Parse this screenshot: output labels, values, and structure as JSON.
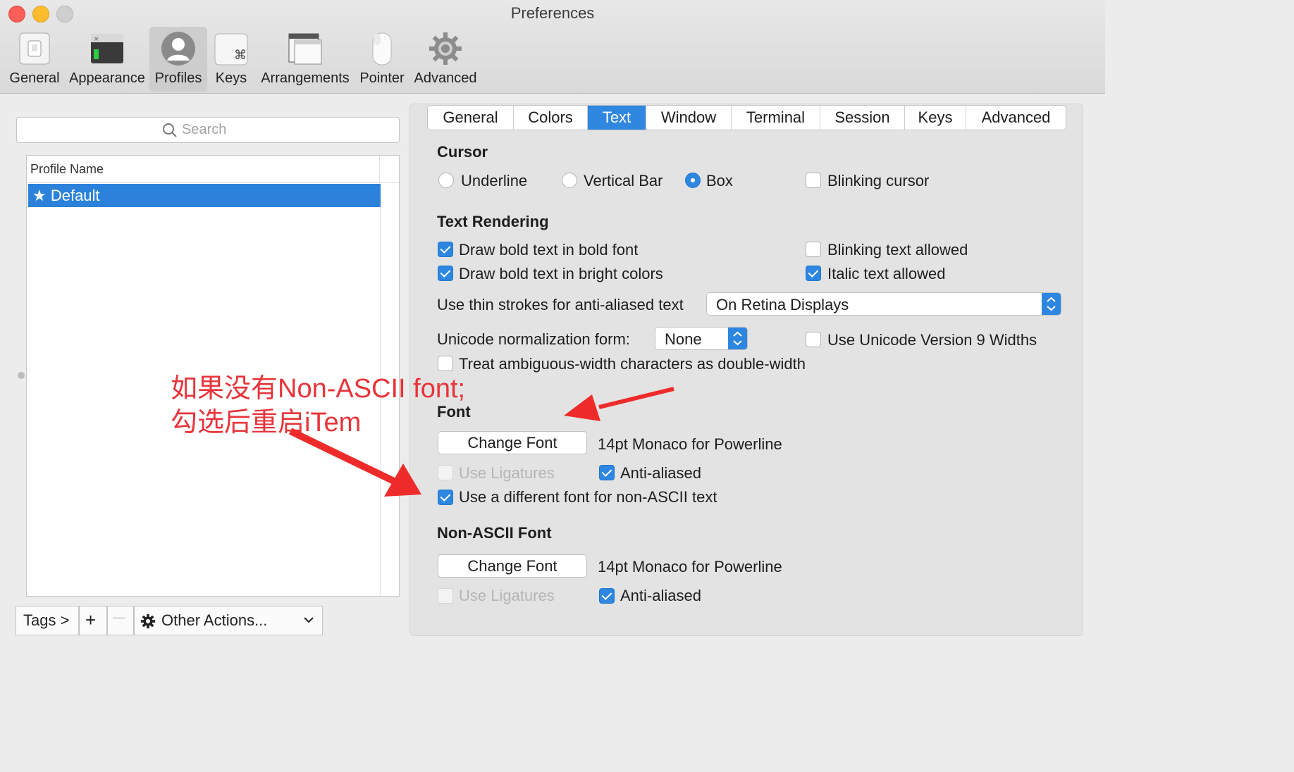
{
  "window": {
    "title": "Preferences"
  },
  "toolbar": {
    "items": [
      {
        "label": "General",
        "icon": "switch-icon"
      },
      {
        "label": "Appearance",
        "icon": "terminal-window-icon"
      },
      {
        "label": "Profiles",
        "icon": "user-silhouette-icon",
        "selected": true
      },
      {
        "label": "Keys",
        "icon": "command-key-icon"
      },
      {
        "label": "Arrangements",
        "icon": "windows-stack-icon"
      },
      {
        "label": "Pointer",
        "icon": "mouse-icon"
      },
      {
        "label": "Advanced",
        "icon": "gear-icon"
      }
    ]
  },
  "sidebar": {
    "search_placeholder": "Search",
    "column_header": "Profile Name",
    "profiles": [
      {
        "label": "★ Default",
        "selected": true
      }
    ],
    "tags_button": "Tags >",
    "add_button": "+",
    "remove_button": "—",
    "other_actions": "Other Actions..."
  },
  "tabs": [
    "General",
    "Colors",
    "Text",
    "Window",
    "Terminal",
    "Session",
    "Keys",
    "Advanced"
  ],
  "active_tab": "Text",
  "cursor": {
    "heading": "Cursor",
    "underline": "Underline",
    "vertical_bar": "Vertical Bar",
    "box": "Box",
    "selected": "Box",
    "blinking": "Blinking cursor",
    "blinking_checked": false
  },
  "text_rendering": {
    "heading": "Text Rendering",
    "bold_font": "Draw bold text in bold font",
    "bold_bright": "Draw bold text in bright colors",
    "blinking_text": "Blinking text allowed",
    "italic_text": "Italic text allowed",
    "thin_strokes_label": "Use thin strokes for anti-aliased text",
    "thin_strokes_value": "On Retina Displays",
    "unicode_label": "Unicode normalization form:",
    "unicode_value": "None",
    "unicode_v9": "Use Unicode Version 9 Widths",
    "ambiguous": "Treat ambiguous-width characters as double-width"
  },
  "font": {
    "heading": "Font",
    "change_font": "Change Font",
    "font_name": "14pt Monaco for Powerline",
    "ligatures": "Use Ligatures",
    "anti_aliased": "Anti-aliased",
    "non_ascii_toggle": "Use a different font for non-ASCII text"
  },
  "non_ascii_font": {
    "heading": "Non-ASCII Font",
    "change_font": "Change Font",
    "font_name": "14pt Monaco for Powerline",
    "ligatures": "Use Ligatures",
    "anti_aliased": "Anti-aliased"
  },
  "annotation": {
    "line1": "如果没有Non-ASCII font;",
    "line2": "勾选后重启iTem",
    "color": "#e8343a"
  },
  "colors": {
    "accent": "#2d86e0",
    "selection": "#2c82da",
    "annotation": "#e8343a"
  }
}
